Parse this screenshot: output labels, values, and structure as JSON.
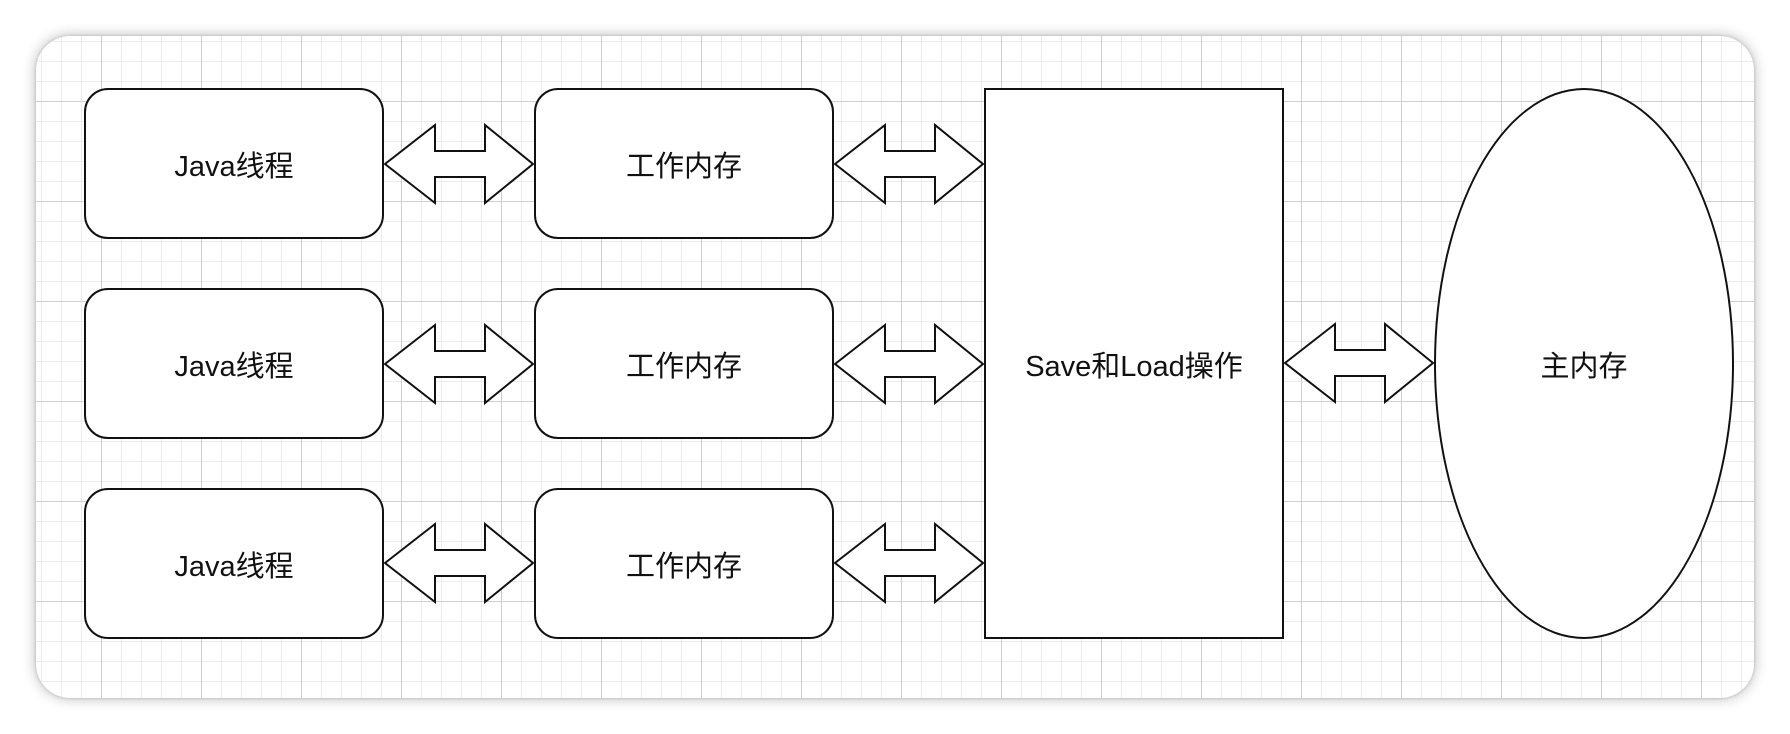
{
  "threads": [
    {
      "label": "Java线程"
    },
    {
      "label": "Java线程"
    },
    {
      "label": "Java线程"
    }
  ],
  "working_memory": [
    {
      "label": "工作内存"
    },
    {
      "label": "工作内存"
    },
    {
      "label": "工作内存"
    }
  ],
  "save_load": {
    "label": "Save和Load操作"
  },
  "main_memory": {
    "label": "主内存"
  }
}
